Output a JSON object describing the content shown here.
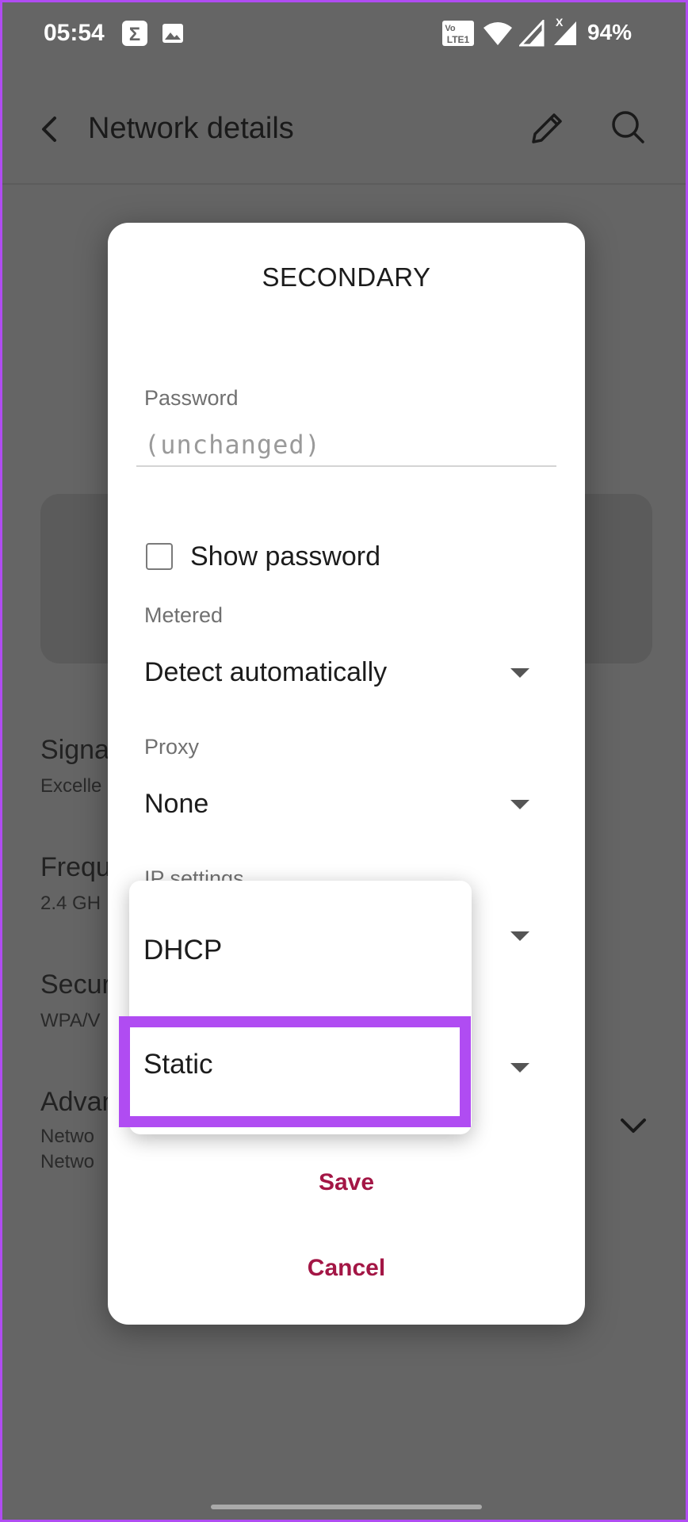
{
  "status_bar": {
    "time": "05:54",
    "lte_badge_top": "Vo",
    "lte_badge_bottom": "LTE1",
    "signal_x_mark": "X",
    "battery": "94%",
    "icons": [
      "sigma-icon",
      "image-icon",
      "volte-icon",
      "wifi-icon",
      "signal-icon",
      "signal-no-icon"
    ]
  },
  "app_bar": {
    "title": "Network details",
    "icons": [
      "back-arrow-icon",
      "edit-pencil-icon",
      "search-icon"
    ]
  },
  "background": {
    "rows": [
      {
        "title": "Signa",
        "sub": "Excelle"
      },
      {
        "title": "Frequ",
        "sub": "2.4 GH"
      },
      {
        "title": "Secur",
        "sub": "WPA/V"
      },
      {
        "title": "Advan",
        "sub": "Netwo",
        "sub2": "Netwo"
      }
    ]
  },
  "dialog": {
    "title": "SECONDARY",
    "password_label": "Password",
    "password_placeholder": "(unchanged)",
    "show_password_label": "Show password",
    "show_password_checked": false,
    "metered_label": "Metered",
    "metered_value": "Detect automatically",
    "proxy_label": "Proxy",
    "proxy_value": "None",
    "ip_settings_label": "IP settings",
    "save_label": "Save",
    "cancel_label": "Cancel",
    "accent_color": "#a31645"
  },
  "ip_dropdown": {
    "options": [
      "DHCP",
      "Static"
    ],
    "highlighted": "Static",
    "highlight_color": "#b04cf2"
  }
}
